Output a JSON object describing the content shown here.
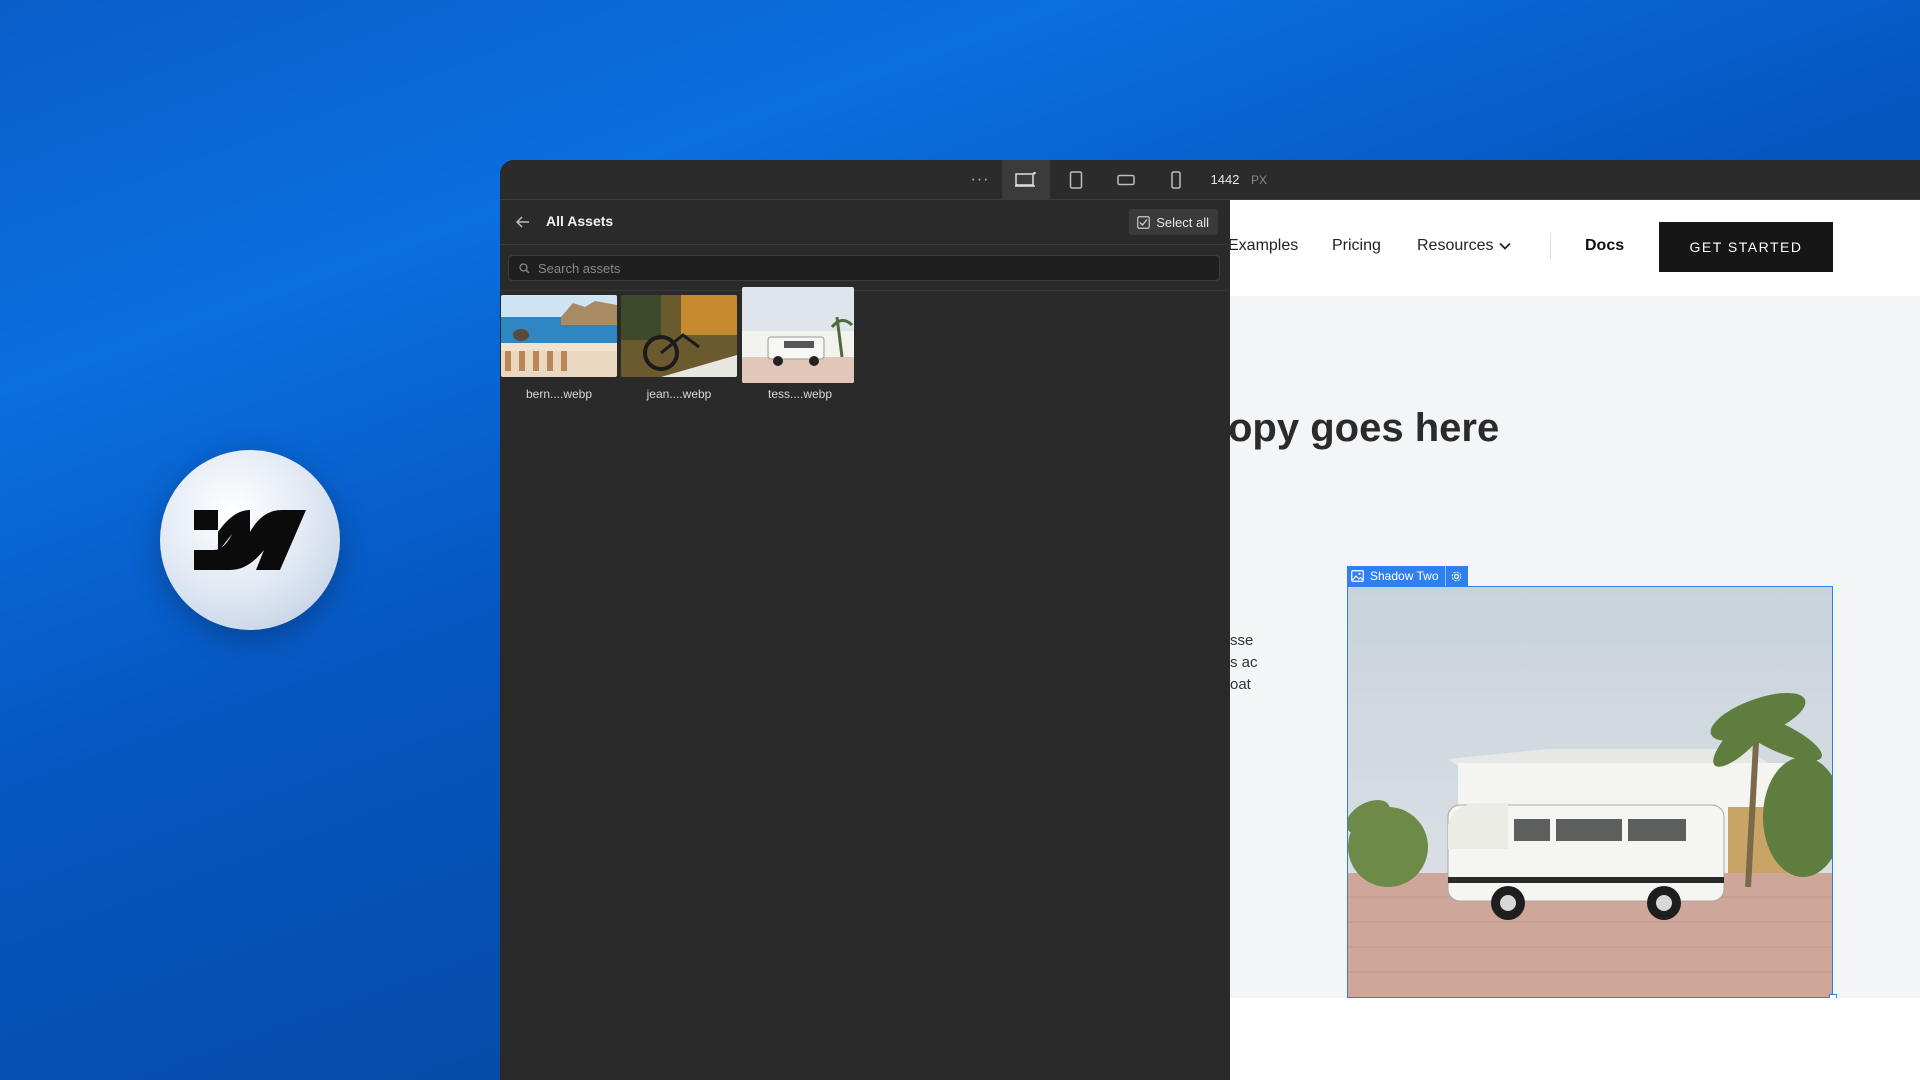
{
  "toolbar": {
    "more_icon": "ellipsis-icon",
    "breakpoints": [
      "desktop-icon",
      "tablet-icon",
      "mobile-landscape-icon",
      "mobile-portrait-icon"
    ],
    "width_value": "1442",
    "width_unit": "PX"
  },
  "assets_panel": {
    "title": "All Assets",
    "back_icon": "arrow-left-icon",
    "select_all_label": "Select all",
    "search_placeholder": "Search assets",
    "items": [
      {
        "name": "bern....webp"
      },
      {
        "name": "jean....webp"
      },
      {
        "name": "tess....webp"
      }
    ]
  },
  "site": {
    "nav": {
      "examples": "Examples",
      "pricing": "Pricing",
      "resources": "Resources",
      "docs": "Docs",
      "cta": "GET STARTED"
    },
    "headline": "opy goes here",
    "body_lines": [
      "sse",
      "s ac",
      "oat"
    ],
    "selection_label": "Shadow Two"
  },
  "colors": {
    "brand_blue": "#0a5ec9",
    "selection_blue": "#2f80ed",
    "panel_bg": "#2a2a2a",
    "cta_bg": "#161616"
  }
}
